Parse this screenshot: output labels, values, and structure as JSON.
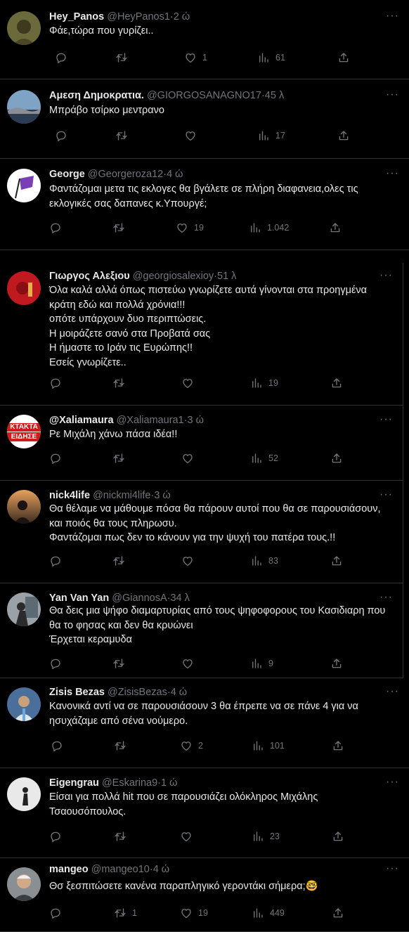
{
  "tweets": [
    {
      "name": "Hey_Panos",
      "handle": "@HeyPanos1",
      "time": "2 ώ",
      "lines": [
        "Φάε,τώρα που γυρίζει.."
      ],
      "replies": "",
      "retweets": "",
      "likes": "1",
      "views": "61"
    },
    {
      "name": "Αμεση Δημοκρατια.",
      "handle": "@GIORGOSANAGNO17",
      "time": "45 λ",
      "lines": [
        "Μπράβο τσίρκο μεντρανο"
      ],
      "replies": "",
      "retweets": "",
      "likes": "",
      "views": "17"
    },
    {
      "name": "George",
      "handle": "@Georgeroza12",
      "time": "4 ώ",
      "lines": [
        "Φαντάζομαι μετα τις εκλογες θα βγάλετε σε πλήρη διαφανεια,ολες τις",
        "εκλογικές σας δαπανες κ.Υπουργέ;"
      ],
      "replies": "",
      "retweets": "",
      "likes": "19",
      "views": "1.042"
    },
    {
      "name": "Γιωργος Αλεξιου",
      "handle": "@georgiosalexioy",
      "time": "51 λ",
      "lines": [
        "Όλα καλά αλλά όπως πιστεύω γνωρίζετε αυτά γίνονται στα προηγμένα",
        "κράτη εδώ και πολλά χρόνια!!!",
        "οπότε υπάρχουν δυο περιπτώσεις.",
        "Η μοιράζετε σανό στα Προβατά σας",
        "Η ήμαστε το Ιράν τις Ευρώπης!!",
        "Εσείς γνωρίζετε.."
      ],
      "replies": "",
      "retweets": "",
      "likes": "",
      "views": "19"
    },
    {
      "name": "@Xaliamaura",
      "handle": "@Xaliamaura1",
      "time": "3 ώ",
      "lines": [
        "Ρε Μιχάλη χάνω πάσα ιδέα!!"
      ],
      "replies": "",
      "retweets": "",
      "likes": "",
      "views": "52",
      "avatar_text": [
        "ΚΤΑΚΤΑ",
        "ΕΙΔΗΣΕ"
      ]
    },
    {
      "name": "nick4life",
      "handle": "@nickmi4life",
      "time": "3 ώ",
      "lines": [
        "Θα θέλαμε να μάθουμε πόσα θα πάρουν αυτοί που θα σε παρουσιάσουν,",
        "και ποιός θα τους πληρωσυ.",
        "Φαντάζομαι πως δεν το κάνουν για την ψυχή του πατέρα τους.!!"
      ],
      "replies": "",
      "retweets": "",
      "likes": "",
      "views": "83"
    },
    {
      "name": "Yan Van Yan",
      "handle": "@GiannosA",
      "time": "34 λ",
      "lines": [
        "Θα δεις μια ψήφο διαμαρτυρίας από τους ψηφοφορους του Κασιδιαρη που",
        "θα το φησας και δεν θα κρυώνει",
        "Έρχεται κεραμυδα"
      ],
      "replies": "",
      "retweets": "",
      "likes": "",
      "views": "9"
    },
    {
      "name": "Zisis Bezas",
      "handle": "@ZisisBezas",
      "time": "4 ώ",
      "lines": [
        "Κανονικά αντί να σε παρουσιάσουν 3 θα έπρεπε να σε πάνε 4 για να",
        "ησυχάζαμε από σένα νούμερο."
      ],
      "replies": "",
      "retweets": "",
      "likes": "2",
      "views": "101"
    },
    {
      "name": "Eigengrau",
      "handle": "@Eskarina9",
      "time": "1 ώ",
      "lines": [
        "Είσαι για πολλά hit που σε παρουσιάζει ολόκληρος Μιχάλης",
        "Τσαουσόπουλος."
      ],
      "replies": "",
      "retweets": "",
      "likes": "",
      "views": "23"
    },
    {
      "name": "mangeo",
      "handle": "@mangeo10",
      "time": "4 ώ",
      "lines": [
        "Θσ ξεσπιτώσετε κανένα παραπληγικό γεροντάκι σήμερα;🤓"
      ],
      "replies": "",
      "retweets": "1",
      "likes": "19",
      "views": "449"
    }
  ],
  "ui": {
    "separator": "·",
    "more": "···"
  },
  "icons": [
    "reply-icon",
    "retweet-icon",
    "like-icon",
    "views-icon",
    "share-icon"
  ]
}
